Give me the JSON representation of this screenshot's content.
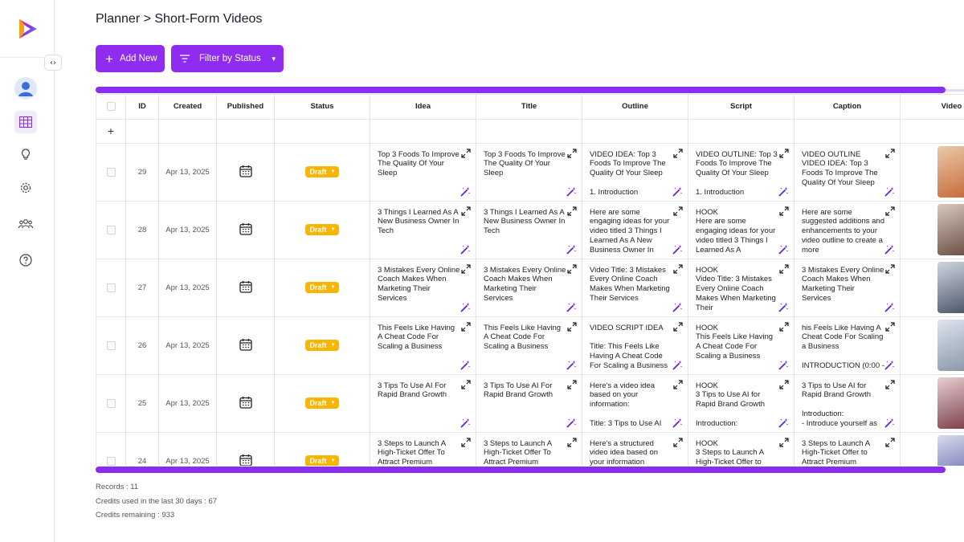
{
  "sidebar": {
    "collapse_label": "‹›",
    "icons": [
      "avatar",
      "grid-icon",
      "bulb-icon",
      "gear-icon",
      "users-icon",
      "help-icon"
    ]
  },
  "header": {
    "breadcrumb": "Planner > Short-Form Videos",
    "add_new_label": "Add New",
    "filter_label": "Filter by Status"
  },
  "table": {
    "columns": [
      "ID",
      "Created",
      "Published",
      "Status",
      "Idea",
      "Title",
      "Outline",
      "Script",
      "Caption",
      "Video Fi"
    ],
    "add_row_symbol": "+",
    "rows": [
      {
        "id": "29",
        "created": "Apr 13, 2025",
        "status": "Draft",
        "idea": "Top 3 Foods To Improve The Quality Of Your Sleep",
        "title": "Top 3 Foods To Improve The Quality Of Your Sleep",
        "outline": "VIDEO IDEA: Top 3 Foods To Improve The Quality Of Your Sleep\n\n1. Introduction",
        "script": "VIDEO OUTLINE: Top 3 Foods To Improve The Quality Of Your Sleep\n\n1. Introduction",
        "caption": "VIDEO OUTLINE\nVIDEO IDEA: Top 3 Foods To Improve The Quality Of Your Sleep"
      },
      {
        "id": "28",
        "created": "Apr 13, 2025",
        "status": "Draft",
        "idea": "3 Things I Learned As A New Business Owner In Tech",
        "title": "3 Things I Learned As A New Business Owner In Tech",
        "outline": "Here are some engaging ideas for your video titled 3 Things I Learned As A New Business Owner In",
        "script": "HOOK\nHere are some engaging ideas for your video titled 3 Things I Learned As A",
        "caption": "Here are some suggested additions and enhancements to your video outline to create a more"
      },
      {
        "id": "27",
        "created": "Apr 13, 2025",
        "status": "Draft",
        "idea": "3 Mistakes Every Online Coach Makes When Marketing Their Services",
        "title": "3 Mistakes Every Online Coach Makes When Marketing Their Services",
        "outline": "Video Title: 3 Mistakes Every Online Coach Makes When Marketing Their Services",
        "script": "HOOK\nVideo Title: 3 Mistakes Every Online Coach Makes When Marketing Their",
        "caption": "3 Mistakes Every Online Coach Makes When Marketing Their Services"
      },
      {
        "id": "26",
        "created": "Apr 13, 2025",
        "status": "Draft",
        "idea": "This Feels Like Having A Cheat Code For Scaling a Business",
        "title": "This Feels Like Having A Cheat Code For Scaling a Business",
        "outline": "VIDEO SCRIPT IDEA\n\nTitle: This Feels Like Having A Cheat Code For Scaling a Business",
        "script": "HOOK\nThis Feels Like Having A Cheat Code For Scaling a Business",
        "caption": "his Feels Like Having A Cheat Code For Scaling a Business\n\nINTRODUCTION (0:00 -"
      },
      {
        "id": "25",
        "created": "Apr 13, 2025",
        "status": "Draft",
        "idea": "3 Tips To Use AI For Rapid Brand Growth",
        "title": "3 Tips To Use AI For Rapid Brand Growth",
        "outline": "Here's a video idea based on your information:\n\nTitle: 3 Tips to Use AI for",
        "script": "HOOK\n3 Tips to Use AI for Rapid Brand Growth\n\nIntroduction:",
        "caption": "3 Tips to Use AI for Rapid Brand Growth\n\nIntroduction:\n- Introduce yourself as"
      },
      {
        "id": "24",
        "created": "Apr 13, 2025",
        "status": "Draft",
        "idea": "3 Steps to Launch A High-Ticket Offer To Attract Premium",
        "title": "3 Steps to Launch A High-Ticket Offer To Attract Premium",
        "outline": "Here's a structured video idea based on your information",
        "script": "HOOK\n3 Steps to Launch A High-Ticket Offer to",
        "caption": "3 Steps to Launch A High-Ticket Offer to Attract Premium"
      }
    ]
  },
  "footer": {
    "records": "Records : 11",
    "credits_used": "Credits used in the last 30 days : 67",
    "credits_remaining": "Credits remaining : 933"
  },
  "colors": {
    "accent": "#8e2cf0",
    "draft_badge": "#f7b500"
  }
}
